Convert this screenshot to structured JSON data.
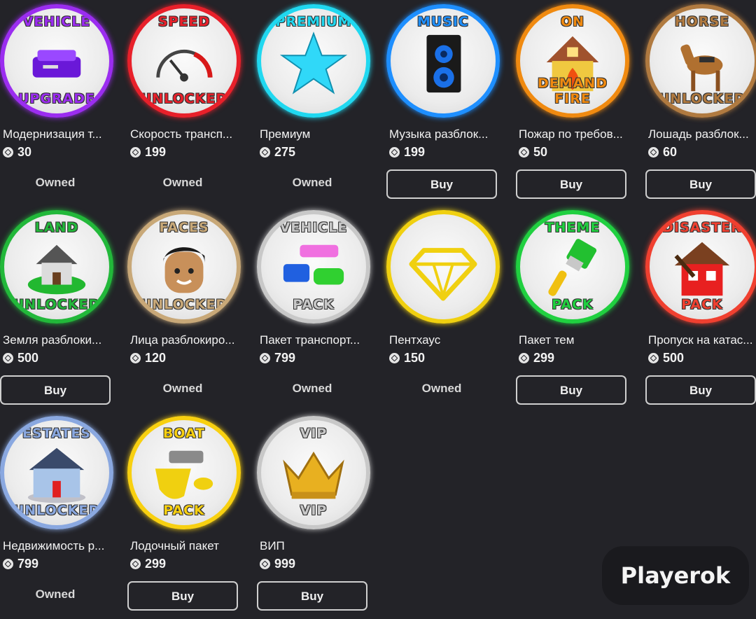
{
  "watermark": "Playerok",
  "items": [
    {
      "badge_top": "VEHICLE",
      "badge_bottom": "UPGRADE",
      "ring": "#9b2df0",
      "icon": "car-icon",
      "name": "Модернизация т...",
      "price": "30",
      "status": "Owned"
    },
    {
      "badge_top": "SPEED",
      "badge_bottom": "UNLOCKED",
      "ring": "#e8202a",
      "icon": "speedometer-icon",
      "name": "Скорость трансп...",
      "price": "199",
      "status": "Owned"
    },
    {
      "badge_top": "PREMIUM",
      "badge_bottom": "",
      "ring": "#20d8f0",
      "icon": "star-icon",
      "name": "Премиум",
      "price": "275",
      "status": "Owned"
    },
    {
      "badge_top": "MUSIC",
      "badge_bottom": "",
      "ring": "#1e8fff",
      "icon": "speaker-icon",
      "name": "Музыка разблок...",
      "price": "199",
      "status": "Buy"
    },
    {
      "badge_top": "ON",
      "badge_bottom": "DEMAND FIRE",
      "ring": "#f08a10",
      "icon": "burning-house-icon",
      "name": "Пожар по требов...",
      "price": "50",
      "status": "Buy"
    },
    {
      "badge_top": "HORSE",
      "badge_bottom": "UNLOCKED",
      "ring": "#b07a40",
      "icon": "horse-icon",
      "name": "Лошадь разблок...",
      "price": "60",
      "status": "Buy"
    },
    {
      "badge_top": "LAND",
      "badge_bottom": "UNLOCKED",
      "ring": "#22b83a",
      "icon": "house-on-island-icon",
      "name": "Земля разблоки...",
      "price": "500",
      "status": "Buy"
    },
    {
      "badge_top": "FACES",
      "badge_bottom": "UNLOCKED",
      "ring": "#c8a878",
      "icon": "avatar-face-icon",
      "name": "Лица разблокиро...",
      "price": "120",
      "status": "Owned"
    },
    {
      "badge_top": "VEHICLE",
      "badge_bottom": "PACK",
      "ring": "#c8c8c8",
      "icon": "vehicles-icon",
      "name": "Пакет транспорт...",
      "price": "799",
      "status": "Owned"
    },
    {
      "badge_top": "",
      "badge_bottom": "",
      "ring": "#f0d010",
      "icon": "diamond-icon",
      "name": "Пентхаус",
      "price": "150",
      "status": "Owned"
    },
    {
      "badge_top": "THEME",
      "badge_bottom": "PACK",
      "ring": "#20d040",
      "icon": "paintbrush-icon",
      "name": "Пакет тем",
      "price": "299",
      "status": "Buy"
    },
    {
      "badge_top": "DISASTER",
      "badge_bottom": "PACK",
      "ring": "#f04030",
      "icon": "broken-house-icon",
      "name": "Пропуск на катас...",
      "price": "500",
      "status": "Buy"
    },
    {
      "badge_top": "ESTATES",
      "badge_bottom": "UNLOCKED",
      "ring": "#8aa8e0",
      "icon": "mansion-icon",
      "name": "Недвижимость р...",
      "price": "799",
      "status": "Owned"
    },
    {
      "badge_top": "BOAT",
      "badge_bottom": "PACK",
      "ring": "#f8d010",
      "icon": "boat-icon",
      "name": "Лодочный пакет",
      "price": "299",
      "status": "Buy"
    },
    {
      "badge_top": "VIP",
      "badge_bottom": "VIP",
      "ring": "#c8c8c8",
      "icon": "crown-icon",
      "name": "ВИП",
      "price": "999",
      "status": "Buy"
    }
  ]
}
